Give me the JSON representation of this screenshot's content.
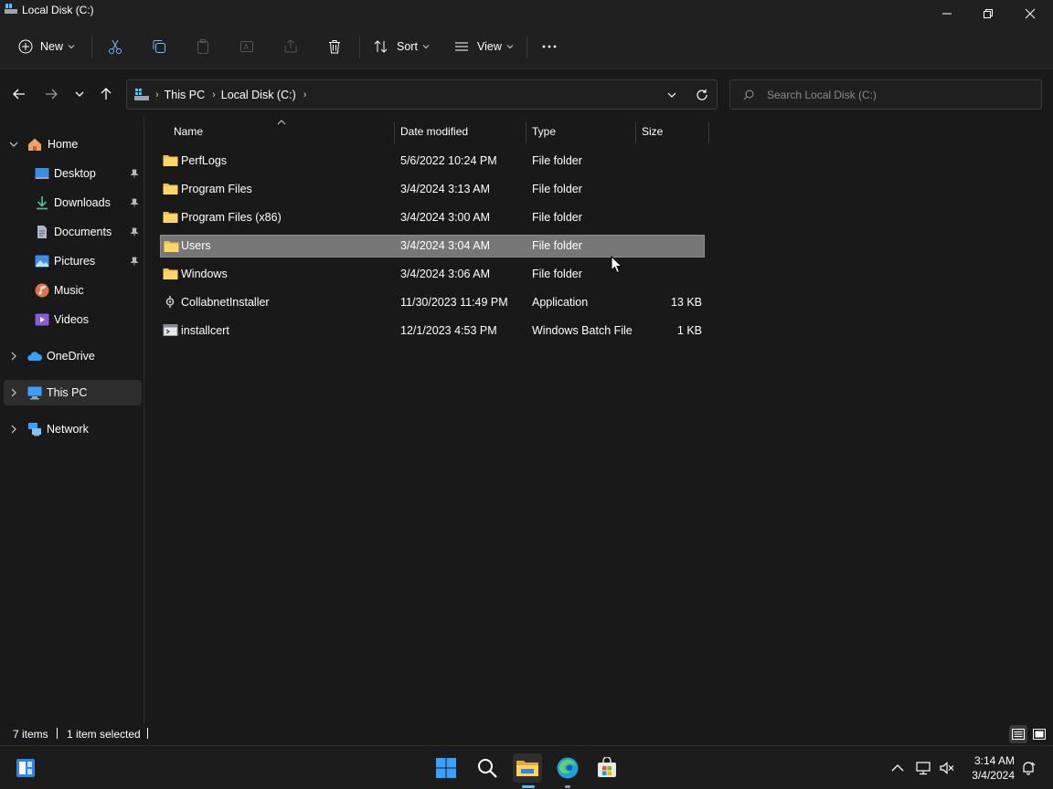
{
  "window": {
    "title": "Local Disk (C:)"
  },
  "toolbar": {
    "new_label": "New",
    "sort_label": "Sort",
    "view_label": "View"
  },
  "address": {
    "crumbs": [
      "This PC",
      "Local Disk (C:)"
    ]
  },
  "search": {
    "placeholder": "Search Local Disk (C:)"
  },
  "sidebar": {
    "items": [
      {
        "label": "Home",
        "icon": "home-icon"
      },
      {
        "label": "Desktop",
        "icon": "desktop-icon"
      },
      {
        "label": "Downloads",
        "icon": "downloads-icon"
      },
      {
        "label": "Documents",
        "icon": "documents-icon"
      },
      {
        "label": "Pictures",
        "icon": "pictures-icon"
      },
      {
        "label": "Music",
        "icon": "music-icon"
      },
      {
        "label": "Videos",
        "icon": "videos-icon"
      },
      {
        "label": "OneDrive",
        "icon": "onedrive-icon"
      },
      {
        "label": "This PC",
        "icon": "computer-icon"
      },
      {
        "label": "Network",
        "icon": "network-icon"
      }
    ]
  },
  "columns": {
    "name": "Name",
    "date": "Date modified",
    "type": "Type",
    "size": "Size"
  },
  "files": [
    {
      "name": "PerfLogs",
      "date": "5/6/2022 10:24 PM",
      "type": "File folder",
      "size": "",
      "icon": "folder-icon"
    },
    {
      "name": "Program Files",
      "date": "3/4/2024 3:13 AM",
      "type": "File folder",
      "size": "",
      "icon": "folder-icon"
    },
    {
      "name": "Program Files (x86)",
      "date": "3/4/2024 3:00 AM",
      "type": "File folder",
      "size": "",
      "icon": "folder-icon"
    },
    {
      "name": "Users",
      "date": "3/4/2024 3:04 AM",
      "type": "File folder",
      "size": "",
      "icon": "folder-icon"
    },
    {
      "name": "Windows",
      "date": "3/4/2024 3:06 AM",
      "type": "File folder",
      "size": "",
      "icon": "folder-icon"
    },
    {
      "name": "CollabnetInstaller",
      "date": "11/30/2023 11:49 PM",
      "type": "Application",
      "size": "13 KB",
      "icon": "application-icon"
    },
    {
      "name": "installcert",
      "date": "12/1/2023 4:53 PM",
      "type": "Windows Batch File",
      "size": "1 KB",
      "icon": "batch-file-icon"
    }
  ],
  "selected_index": 3,
  "status": {
    "count": "7 items",
    "selection": "1 item selected"
  },
  "taskbar": {
    "time": "3:14 AM",
    "date": "3/4/2024"
  },
  "colors": {
    "selected_row": "#777777",
    "folder": "#f2c04d",
    "accent": "#4cc2ff"
  }
}
